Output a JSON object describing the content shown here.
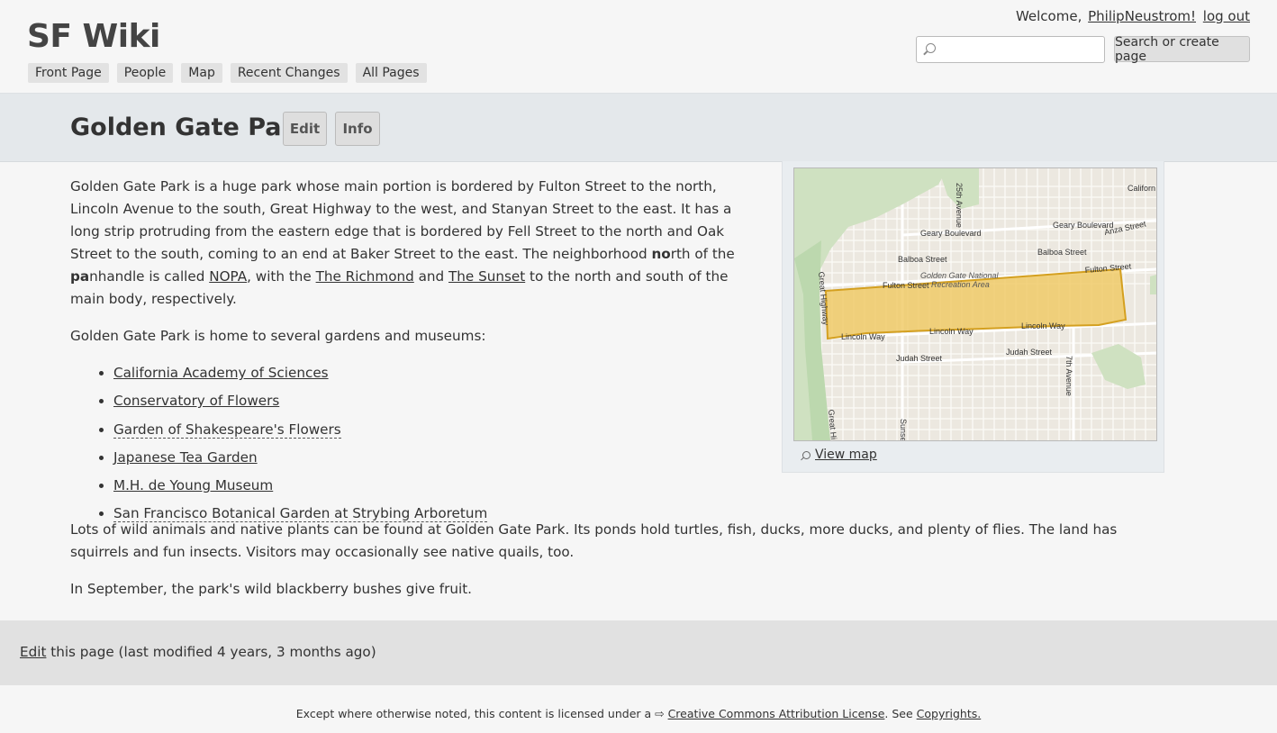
{
  "site": {
    "title": "SF Wiki"
  },
  "nav": [
    "Front Page",
    "People",
    "Map",
    "Recent Changes",
    "All Pages"
  ],
  "user": {
    "welcome": "Welcome,",
    "name": "PhilipNeustrom!",
    "logout": "log out"
  },
  "search": {
    "placeholder": "",
    "button": "Search or create page",
    "icon": "search-icon"
  },
  "page": {
    "title": "Golden Gate Park",
    "edit_label": "Edit",
    "info_label": "Info"
  },
  "content": {
    "p1_a": "Golden Gate Park is a huge park whose main portion is bordered by Fulton Street to the north, Lincoln Avenue to the south, Great Highway to the west, and Stanyan Street to the east. It has a long strip protruding from the eastern edge that is bordered by Fell Street to the north and Oak Street to the south, coming to an end at Baker Street to the east. The neighborhood ",
    "p1_no": "no",
    "p1_b": "rth of the ",
    "p1_pa": "pa",
    "p1_c": "nhandle is called ",
    "p1_link1": "NOPA",
    "p1_d": ", with the ",
    "p1_link2": "The Richmond",
    "p1_e": " and ",
    "p1_link3": "The Sunset",
    "p1_f": " to the north and south of the main body, respectively.",
    "p2": "Golden Gate Park is home to several gardens and museums:",
    "gardens": [
      "California Academy of Sciences",
      "Conservatory of Flowers",
      "Garden of Shakespeare's Flowers",
      "Japanese Tea Garden",
      "M.H. de Young Museum",
      "San Francisco Botanical Garden at Strybing Arboretum"
    ],
    "p3": "Lots of wild animals and native plants can be found at Golden Gate Park. Its ponds hold turtles, fish, ducks, more ducks, and plenty of flies. The land has squirrels and fun insects. Visitors may occasionally see native quails, too.",
    "p4": "In September, the park's wild blackberry bushes give fruit."
  },
  "map": {
    "view_map": "View map",
    "labels": {
      "ave25": "25th Avenue",
      "geary1": "Geary Boulevard",
      "geary2": "Geary Boulevard",
      "anza": "Anza Street",
      "balboa1": "Balboa Street",
      "balboa2": "Balboa Street",
      "gg1": "Golden Gate National",
      "gg2": "Recreation Area",
      "fulton1": "Fulton Street",
      "fulton2": "Fulton Street",
      "great_hwy1": "Great Highway",
      "great_hwy2": "Great Hi",
      "lincoln1": "Lincoln Way",
      "lincoln2": "Lincoln Way",
      "lincoln3": "Lincoln Way",
      "judah1": "Judah Street",
      "judah2": "Judah Street",
      "ave7": "7th Avenue",
      "sunset": "Sunset",
      "california": "Californ"
    }
  },
  "footer": {
    "edit": "Edit",
    "modified": " this page (last modified 4 years, 3 months ago)"
  },
  "license": {
    "pre": "Except where otherwise noted, this content is licensed under a ",
    "link": "Creative Commons Attribution License",
    "mid": ". See ",
    "copyrights": "Copyrights."
  },
  "colors": {
    "park_fill": "#f0c860",
    "park_stroke": "#d4a020",
    "title_band": "#e4e8eb",
    "footer_band": "#e1e1e1"
  }
}
